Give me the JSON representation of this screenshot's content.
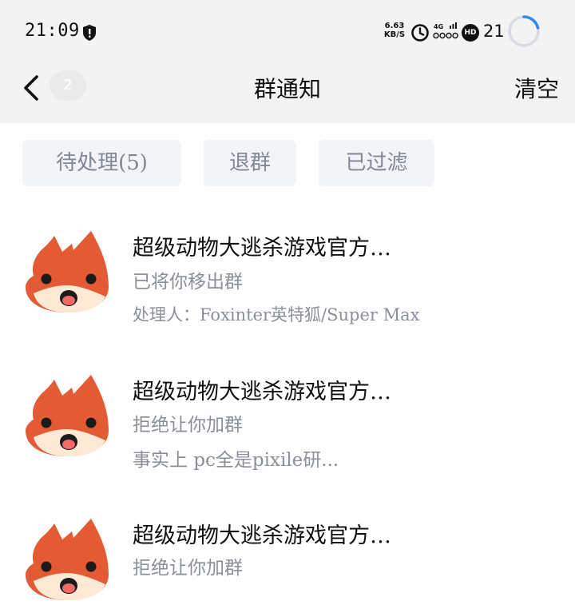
{
  "status_bar": {
    "time": "21:09",
    "net_speed_value": "6.63",
    "net_speed_unit": "KB/S",
    "network_label": "4G",
    "hd_label": "HD",
    "battery": "21",
    "icons": [
      "shield-icon",
      "alarm-icon",
      "signal-icon",
      "hd-icon",
      "battery-ring-icon"
    ]
  },
  "nav": {
    "back_icon": "chevron-left-icon",
    "badge_count": "2",
    "title": "群通知",
    "clear_label": "清空"
  },
  "filters": [
    {
      "label": "待处理(5)"
    },
    {
      "label": "退群"
    },
    {
      "label": "已过滤"
    }
  ],
  "notifications": [
    {
      "group_name": "超级动物大逃杀游戏官方…",
      "status": "已将你移出群",
      "detail": "处理人：Foxinter英特狐/Super Max",
      "avatar_icon": "fox-avatar-icon"
    },
    {
      "group_name": "超级动物大逃杀游戏官方…",
      "status": "拒绝让你加群",
      "detail": "事实上 pc全是pixile研...",
      "avatar_icon": "fox-avatar-icon"
    },
    {
      "group_name": "超级动物大逃杀游戏官方…",
      "status": "拒绝让你加群",
      "avatar_icon": "fox-avatar-icon"
    }
  ],
  "colors": {
    "header_bg": "#f3f3f3",
    "filter_bg": "#f2f4f7",
    "filter_text": "#808796",
    "secondary_text": "#8a8f99",
    "battery_ring": "#2d8cf0",
    "fox_orange": "#e25b35",
    "fox_cream": "#fde9d6"
  }
}
